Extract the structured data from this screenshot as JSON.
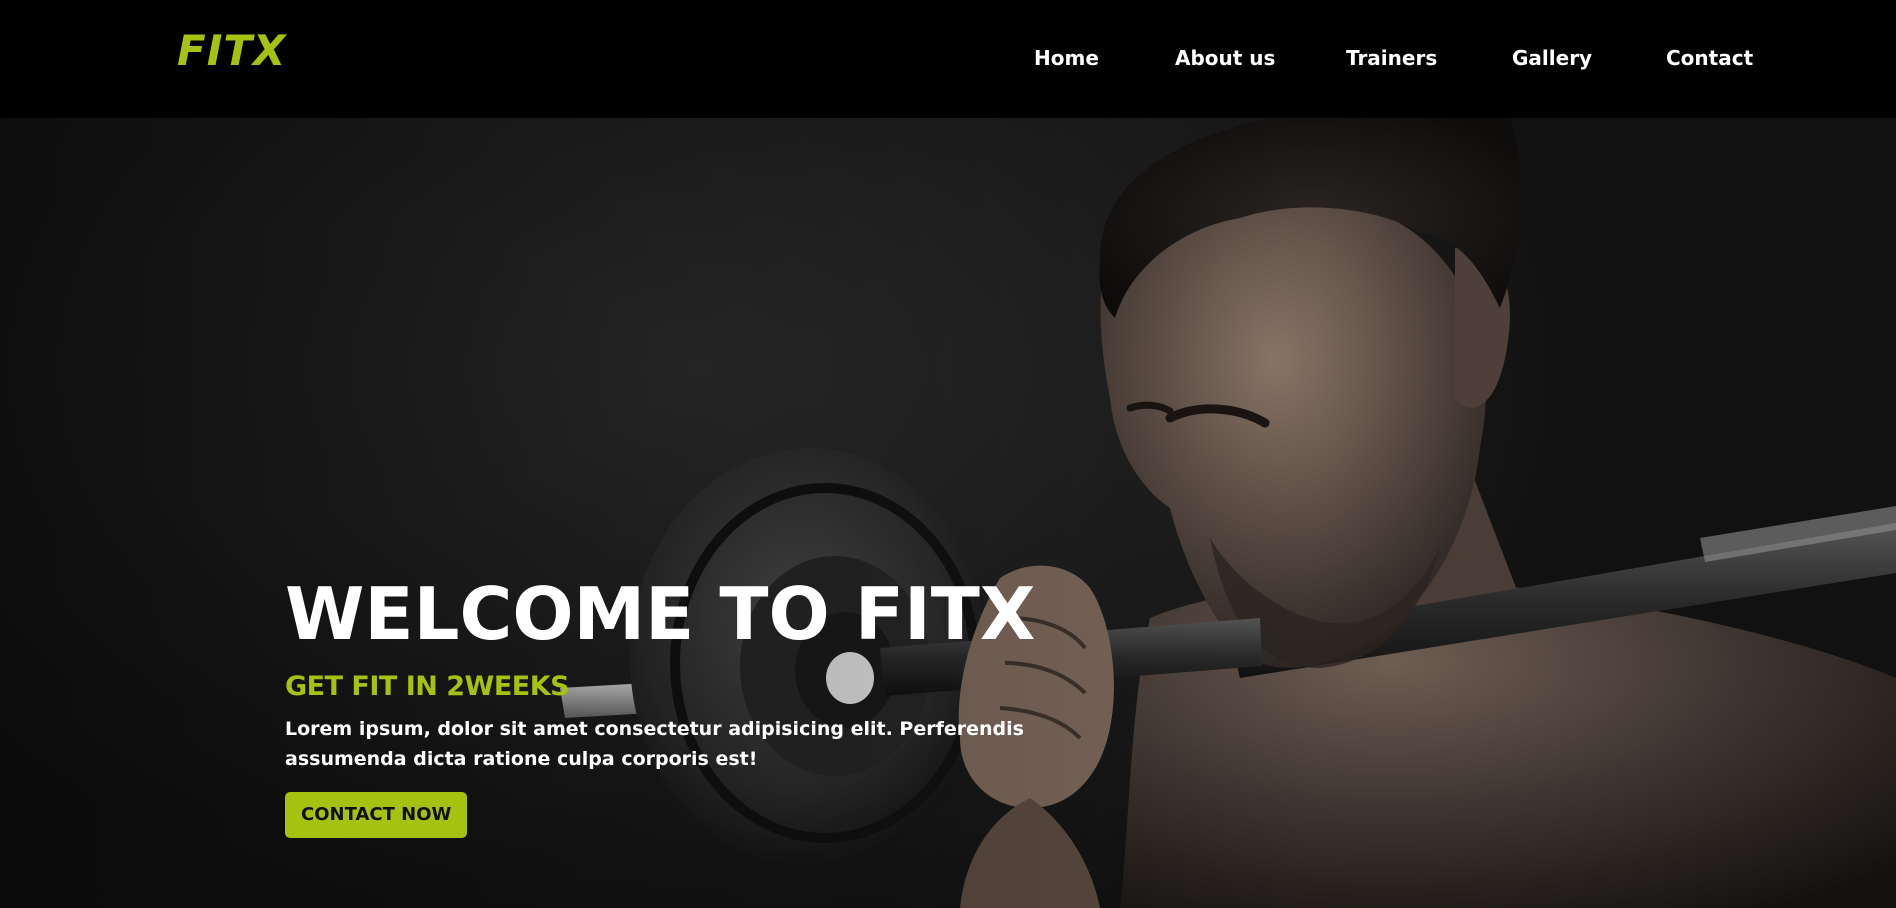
{
  "brand": {
    "logo_text": "FITX",
    "accent_color": "#a4c20f",
    "background_color": "#000000"
  },
  "nav": {
    "items": [
      {
        "label": "Home"
      },
      {
        "label": "About us"
      },
      {
        "label": "Trainers"
      },
      {
        "label": "Gallery"
      },
      {
        "label": "Contact"
      }
    ]
  },
  "hero": {
    "background_image": "man-lifting-barbell-photo",
    "title": "WELCOME TO FITX",
    "subtitle": "GET FIT IN 2WEEKS",
    "description": "Lorem ipsum, dolor sit amet consectetur adipisicing elit. Perferendis assumenda dicta ratione culpa corporis est!",
    "cta_label": "CONTACT NOW"
  }
}
